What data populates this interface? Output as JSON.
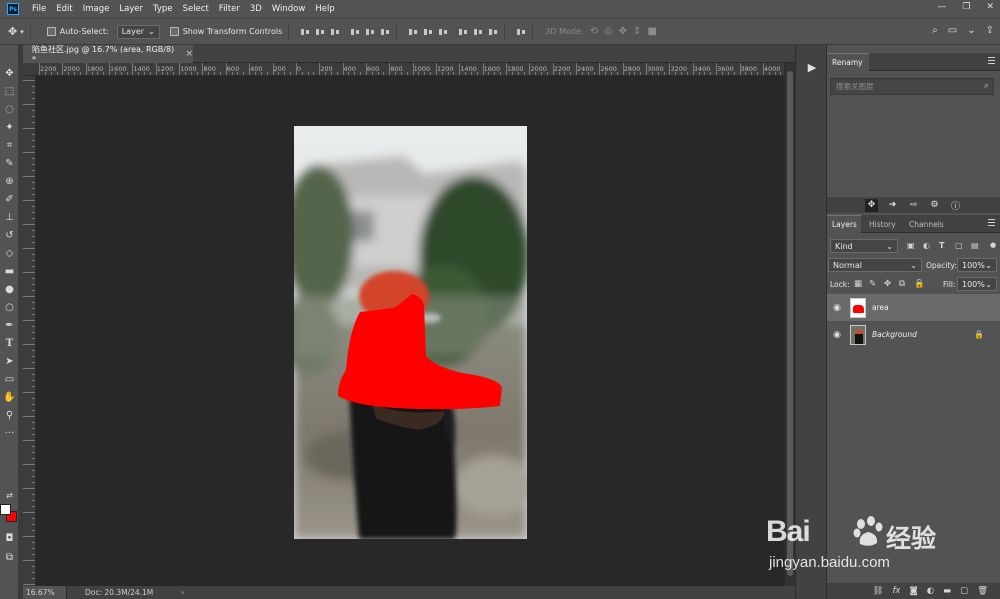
{
  "app": {
    "logo": "Ps"
  },
  "menu": [
    "File",
    "Edit",
    "Image",
    "Layer",
    "Type",
    "Select",
    "Filter",
    "3D",
    "Window",
    "Help"
  ],
  "window_controls": [
    "—",
    "❐",
    "✕"
  ],
  "options_bar": {
    "auto_select_label": "Auto-Select:",
    "auto_select_target": "Layer",
    "show_transform_label": "Show Transform Controls",
    "mode_3d_label": "3D Mode:"
  },
  "document": {
    "tab_title": "陷鱼社区.jpg @ 16.7% (area, RGB/8) *",
    "tab_close": "×",
    "ruler_labels": [
      "2200",
      "2000",
      "1800",
      "1600",
      "1400",
      "1200",
      "1000",
      "800",
      "600",
      "400",
      "200",
      "0",
      "200",
      "400",
      "600",
      "800",
      "1000",
      "1200",
      "1400",
      "1600",
      "1800",
      "2000",
      "2200",
      "2400",
      "2600",
      "2800",
      "3000",
      "3200",
      "3400",
      "3600",
      "3800",
      "4000"
    ]
  },
  "status": {
    "zoom": "16.67%",
    "doc_info": "Doc: 20.3M/24.1M",
    "arrow": "›"
  },
  "dock": {
    "play_icon": "▶"
  },
  "renamy_panel": {
    "title": "Renamy",
    "search_placeholder": "搜索关图层",
    "search_icon": "⌕"
  },
  "layers_panel": {
    "tabs": [
      "Layers",
      "History",
      "Channels"
    ],
    "kind_filter": "Kind",
    "blend_mode": "Normal",
    "opacity_label": "Opacity:",
    "opacity_value": "100%",
    "lock_label": "Lock:",
    "fill_label": "Fill:",
    "fill_value": "100%",
    "layers": [
      {
        "name": "area",
        "visible": true,
        "selected": true
      },
      {
        "name": "Background",
        "visible": true,
        "locked": true
      }
    ],
    "footer_icons": [
      "link-icon",
      "fx-icon",
      "mask-icon",
      "adjustment-icon",
      "group-icon",
      "new-layer-icon",
      "trash-icon"
    ]
  },
  "watermark": {
    "brand": "Bai",
    "brand2": "经验",
    "url": "jingyan.baidu.com"
  },
  "colors": {
    "foreground": "#ffffff",
    "background": "#ff0000",
    "accent": "#31a8ff",
    "shoe_mask": "#ff0000"
  }
}
